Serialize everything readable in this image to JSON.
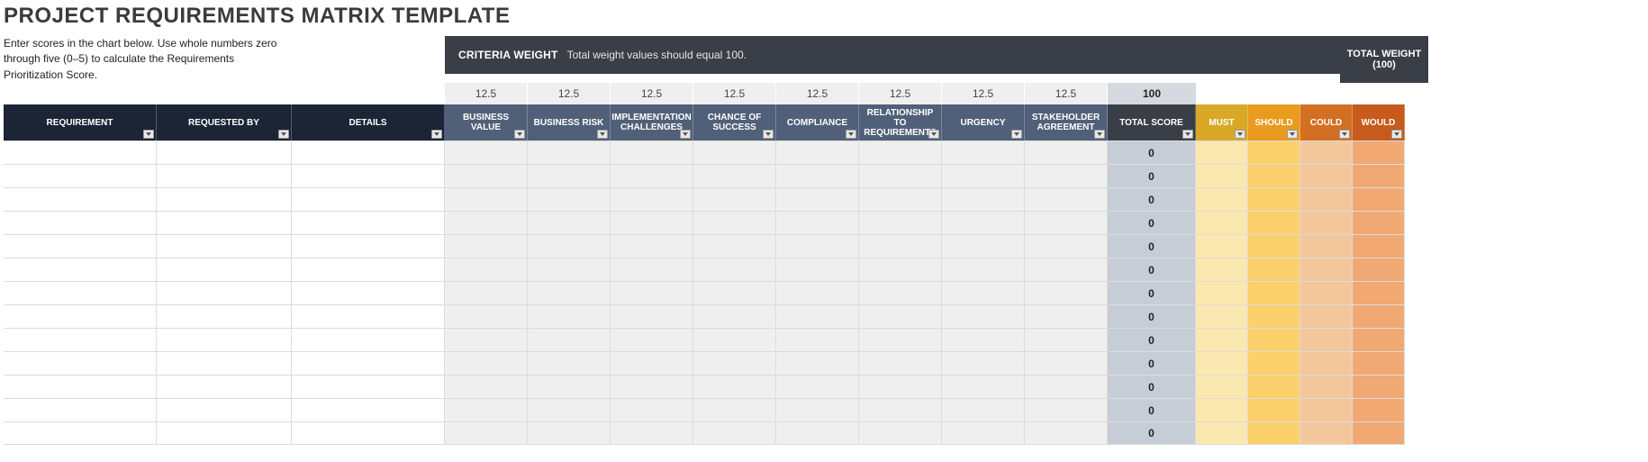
{
  "title": "PROJECT REQUIREMENTS MATRIX TEMPLATE",
  "instructions": "Enter scores in the chart below. Use whole numbers zero through five (0–5) to calculate the Requirements Prioritization Score.",
  "criteria_band": {
    "label": "CRITERIA WEIGHT",
    "hint": "Total weight values should equal 100.",
    "total_label": "TOTAL WEIGHT (100)"
  },
  "left_headers": {
    "requirement": "REQUIREMENT",
    "requested_by": "REQUESTED BY",
    "details": "DETAILS"
  },
  "criteria": [
    {
      "label": "BUSINESS VALUE",
      "weight": "12.5"
    },
    {
      "label": "BUSINESS RISK",
      "weight": "12.5"
    },
    {
      "label": "IMPLEMENTATION CHALLENGES",
      "weight": "12.5"
    },
    {
      "label": "CHANCE OF SUCCESS",
      "weight": "12.5"
    },
    {
      "label": "COMPLIANCE",
      "weight": "12.5"
    },
    {
      "label": "RELATIONSHIP TO REQUIREMENTS",
      "weight": "12.5"
    },
    {
      "label": "URGENCY",
      "weight": "12.5"
    },
    {
      "label": "STAKEHOLDER AGREEMENT",
      "weight": "12.5"
    }
  ],
  "weights_total": "100",
  "total_score_label": "TOTAL SCORE",
  "moscow": {
    "must": "MUST",
    "should": "SHOULD",
    "could": "COULD",
    "would": "WOULD"
  },
  "rows": [
    {
      "requirement": "",
      "requested_by": "",
      "details": "",
      "scores": [
        "",
        "",
        "",
        "",
        "",
        "",
        "",
        ""
      ],
      "total": "0",
      "must": "",
      "should": "",
      "could": "",
      "would": ""
    },
    {
      "requirement": "",
      "requested_by": "",
      "details": "",
      "scores": [
        "",
        "",
        "",
        "",
        "",
        "",
        "",
        ""
      ],
      "total": "0",
      "must": "",
      "should": "",
      "could": "",
      "would": ""
    },
    {
      "requirement": "",
      "requested_by": "",
      "details": "",
      "scores": [
        "",
        "",
        "",
        "",
        "",
        "",
        "",
        ""
      ],
      "total": "0",
      "must": "",
      "should": "",
      "could": "",
      "would": ""
    },
    {
      "requirement": "",
      "requested_by": "",
      "details": "",
      "scores": [
        "",
        "",
        "",
        "",
        "",
        "",
        "",
        ""
      ],
      "total": "0",
      "must": "",
      "should": "",
      "could": "",
      "would": ""
    },
    {
      "requirement": "",
      "requested_by": "",
      "details": "",
      "scores": [
        "",
        "",
        "",
        "",
        "",
        "",
        "",
        ""
      ],
      "total": "0",
      "must": "",
      "should": "",
      "could": "",
      "would": ""
    },
    {
      "requirement": "",
      "requested_by": "",
      "details": "",
      "scores": [
        "",
        "",
        "",
        "",
        "",
        "",
        "",
        ""
      ],
      "total": "0",
      "must": "",
      "should": "",
      "could": "",
      "would": ""
    },
    {
      "requirement": "",
      "requested_by": "",
      "details": "",
      "scores": [
        "",
        "",
        "",
        "",
        "",
        "",
        "",
        ""
      ],
      "total": "0",
      "must": "",
      "should": "",
      "could": "",
      "would": ""
    },
    {
      "requirement": "",
      "requested_by": "",
      "details": "",
      "scores": [
        "",
        "",
        "",
        "",
        "",
        "",
        "",
        ""
      ],
      "total": "0",
      "must": "",
      "should": "",
      "could": "",
      "would": ""
    },
    {
      "requirement": "",
      "requested_by": "",
      "details": "",
      "scores": [
        "",
        "",
        "",
        "",
        "",
        "",
        "",
        ""
      ],
      "total": "0",
      "must": "",
      "should": "",
      "could": "",
      "would": ""
    },
    {
      "requirement": "",
      "requested_by": "",
      "details": "",
      "scores": [
        "",
        "",
        "",
        "",
        "",
        "",
        "",
        ""
      ],
      "total": "0",
      "must": "",
      "should": "",
      "could": "",
      "would": ""
    },
    {
      "requirement": "",
      "requested_by": "",
      "details": "",
      "scores": [
        "",
        "",
        "",
        "",
        "",
        "",
        "",
        ""
      ],
      "total": "0",
      "must": "",
      "should": "",
      "could": "",
      "would": ""
    },
    {
      "requirement": "",
      "requested_by": "",
      "details": "",
      "scores": [
        "",
        "",
        "",
        "",
        "",
        "",
        "",
        ""
      ],
      "total": "0",
      "must": "",
      "should": "",
      "could": "",
      "would": ""
    },
    {
      "requirement": "",
      "requested_by": "",
      "details": "",
      "scores": [
        "",
        "",
        "",
        "",
        "",
        "",
        "",
        ""
      ],
      "total": "0",
      "must": "",
      "should": "",
      "could": "",
      "would": ""
    }
  ]
}
